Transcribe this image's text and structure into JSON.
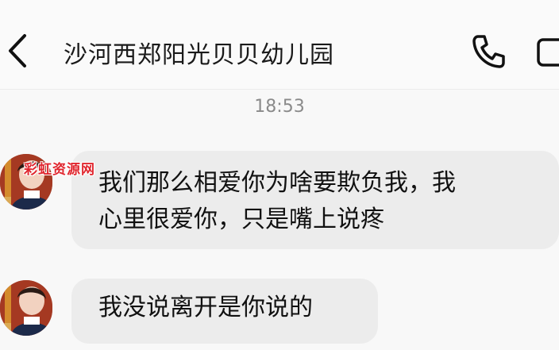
{
  "header": {
    "title": "沙河西郑阳光贝贝幼儿园",
    "back_icon": "chevron-left-icon",
    "call_icon": "phone-icon",
    "video_icon": "video-icon"
  },
  "chat": {
    "timestamp": "18:53",
    "messages": [
      {
        "lines": [
          "我们那么相爱你为啥要欺负我，我",
          "心里很爱你，只是嘴上说疼"
        ]
      },
      {
        "lines": [
          "我没说离开是你说的"
        ]
      }
    ]
  },
  "watermark": "彩虹资源网",
  "colors": {
    "bubble": "#ececec",
    "chat_background": "#f8f8f8",
    "watermark": "#e0262e"
  }
}
